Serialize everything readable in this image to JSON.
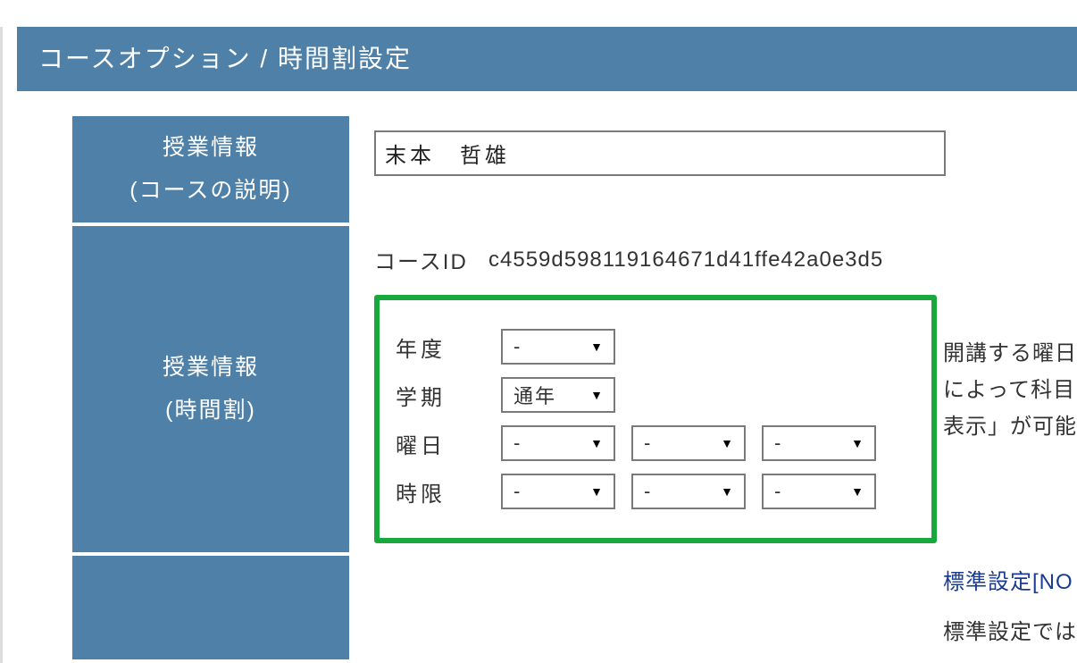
{
  "header": {
    "title": "コースオプション / 時間割設定"
  },
  "rows": {
    "desc": {
      "label_line1": "授業情報",
      "label_line2": "(コースの説明)",
      "instructor_name": "末本　哲雄"
    },
    "timetable": {
      "label_line1": "授業情報",
      "label_line2": "(時間割)",
      "course_id": {
        "label": "コースID",
        "value": "c4559d598119164671d41ffe42a0e3d5"
      },
      "fields": {
        "year": {
          "label": "年度",
          "value": "-"
        },
        "term": {
          "label": "学期",
          "value": "通年"
        },
        "day": {
          "label": "曜日",
          "values": [
            "-",
            "-",
            "-"
          ]
        },
        "period": {
          "label": "時限",
          "values": [
            "-",
            "-",
            "-"
          ]
        }
      }
    }
  },
  "right": {
    "block1_line1": "開講する曜日",
    "block1_line2": "によって科目",
    "block1_line3": "表示」が可能",
    "block2": "標準設定[NO",
    "block3": "標準設定では"
  }
}
